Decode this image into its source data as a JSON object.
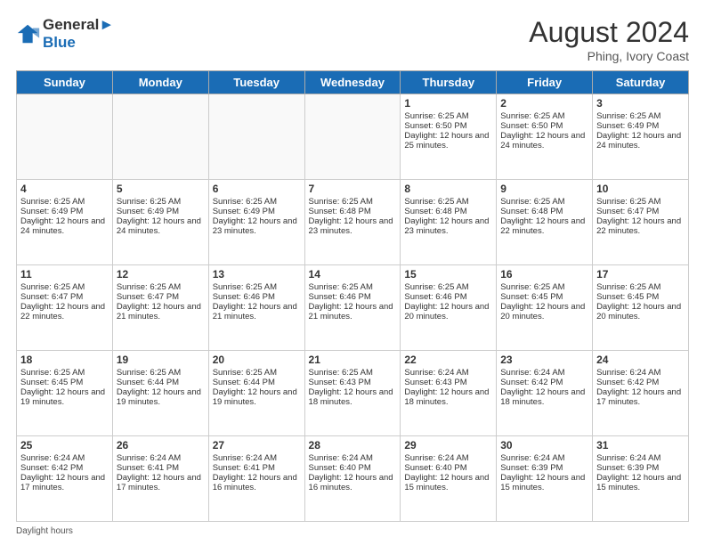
{
  "header": {
    "logo_line1": "General",
    "logo_line2": "Blue",
    "month_title": "August 2024",
    "location": "Phing, Ivory Coast"
  },
  "footer": {
    "label": "Daylight hours"
  },
  "days_of_week": [
    "Sunday",
    "Monday",
    "Tuesday",
    "Wednesday",
    "Thursday",
    "Friday",
    "Saturday"
  ],
  "weeks": [
    [
      {
        "day": "",
        "info": ""
      },
      {
        "day": "",
        "info": ""
      },
      {
        "day": "",
        "info": ""
      },
      {
        "day": "",
        "info": ""
      },
      {
        "day": "1",
        "info": "Sunrise: 6:25 AM\nSunset: 6:50 PM\nDaylight: 12 hours and 25 minutes."
      },
      {
        "day": "2",
        "info": "Sunrise: 6:25 AM\nSunset: 6:50 PM\nDaylight: 12 hours and 24 minutes."
      },
      {
        "day": "3",
        "info": "Sunrise: 6:25 AM\nSunset: 6:49 PM\nDaylight: 12 hours and 24 minutes."
      }
    ],
    [
      {
        "day": "4",
        "info": "Sunrise: 6:25 AM\nSunset: 6:49 PM\nDaylight: 12 hours and 24 minutes."
      },
      {
        "day": "5",
        "info": "Sunrise: 6:25 AM\nSunset: 6:49 PM\nDaylight: 12 hours and 24 minutes."
      },
      {
        "day": "6",
        "info": "Sunrise: 6:25 AM\nSunset: 6:49 PM\nDaylight: 12 hours and 23 minutes."
      },
      {
        "day": "7",
        "info": "Sunrise: 6:25 AM\nSunset: 6:48 PM\nDaylight: 12 hours and 23 minutes."
      },
      {
        "day": "8",
        "info": "Sunrise: 6:25 AM\nSunset: 6:48 PM\nDaylight: 12 hours and 23 minutes."
      },
      {
        "day": "9",
        "info": "Sunrise: 6:25 AM\nSunset: 6:48 PM\nDaylight: 12 hours and 22 minutes."
      },
      {
        "day": "10",
        "info": "Sunrise: 6:25 AM\nSunset: 6:47 PM\nDaylight: 12 hours and 22 minutes."
      }
    ],
    [
      {
        "day": "11",
        "info": "Sunrise: 6:25 AM\nSunset: 6:47 PM\nDaylight: 12 hours and 22 minutes."
      },
      {
        "day": "12",
        "info": "Sunrise: 6:25 AM\nSunset: 6:47 PM\nDaylight: 12 hours and 21 minutes."
      },
      {
        "day": "13",
        "info": "Sunrise: 6:25 AM\nSunset: 6:46 PM\nDaylight: 12 hours and 21 minutes."
      },
      {
        "day": "14",
        "info": "Sunrise: 6:25 AM\nSunset: 6:46 PM\nDaylight: 12 hours and 21 minutes."
      },
      {
        "day": "15",
        "info": "Sunrise: 6:25 AM\nSunset: 6:46 PM\nDaylight: 12 hours and 20 minutes."
      },
      {
        "day": "16",
        "info": "Sunrise: 6:25 AM\nSunset: 6:45 PM\nDaylight: 12 hours and 20 minutes."
      },
      {
        "day": "17",
        "info": "Sunrise: 6:25 AM\nSunset: 6:45 PM\nDaylight: 12 hours and 20 minutes."
      }
    ],
    [
      {
        "day": "18",
        "info": "Sunrise: 6:25 AM\nSunset: 6:45 PM\nDaylight: 12 hours and 19 minutes."
      },
      {
        "day": "19",
        "info": "Sunrise: 6:25 AM\nSunset: 6:44 PM\nDaylight: 12 hours and 19 minutes."
      },
      {
        "day": "20",
        "info": "Sunrise: 6:25 AM\nSunset: 6:44 PM\nDaylight: 12 hours and 19 minutes."
      },
      {
        "day": "21",
        "info": "Sunrise: 6:25 AM\nSunset: 6:43 PM\nDaylight: 12 hours and 18 minutes."
      },
      {
        "day": "22",
        "info": "Sunrise: 6:24 AM\nSunset: 6:43 PM\nDaylight: 12 hours and 18 minutes."
      },
      {
        "day": "23",
        "info": "Sunrise: 6:24 AM\nSunset: 6:42 PM\nDaylight: 12 hours and 18 minutes."
      },
      {
        "day": "24",
        "info": "Sunrise: 6:24 AM\nSunset: 6:42 PM\nDaylight: 12 hours and 17 minutes."
      }
    ],
    [
      {
        "day": "25",
        "info": "Sunrise: 6:24 AM\nSunset: 6:42 PM\nDaylight: 12 hours and 17 minutes."
      },
      {
        "day": "26",
        "info": "Sunrise: 6:24 AM\nSunset: 6:41 PM\nDaylight: 12 hours and 17 minutes."
      },
      {
        "day": "27",
        "info": "Sunrise: 6:24 AM\nSunset: 6:41 PM\nDaylight: 12 hours and 16 minutes."
      },
      {
        "day": "28",
        "info": "Sunrise: 6:24 AM\nSunset: 6:40 PM\nDaylight: 12 hours and 16 minutes."
      },
      {
        "day": "29",
        "info": "Sunrise: 6:24 AM\nSunset: 6:40 PM\nDaylight: 12 hours and 15 minutes."
      },
      {
        "day": "30",
        "info": "Sunrise: 6:24 AM\nSunset: 6:39 PM\nDaylight: 12 hours and 15 minutes."
      },
      {
        "day": "31",
        "info": "Sunrise: 6:24 AM\nSunset: 6:39 PM\nDaylight: 12 hours and 15 minutes."
      }
    ]
  ]
}
